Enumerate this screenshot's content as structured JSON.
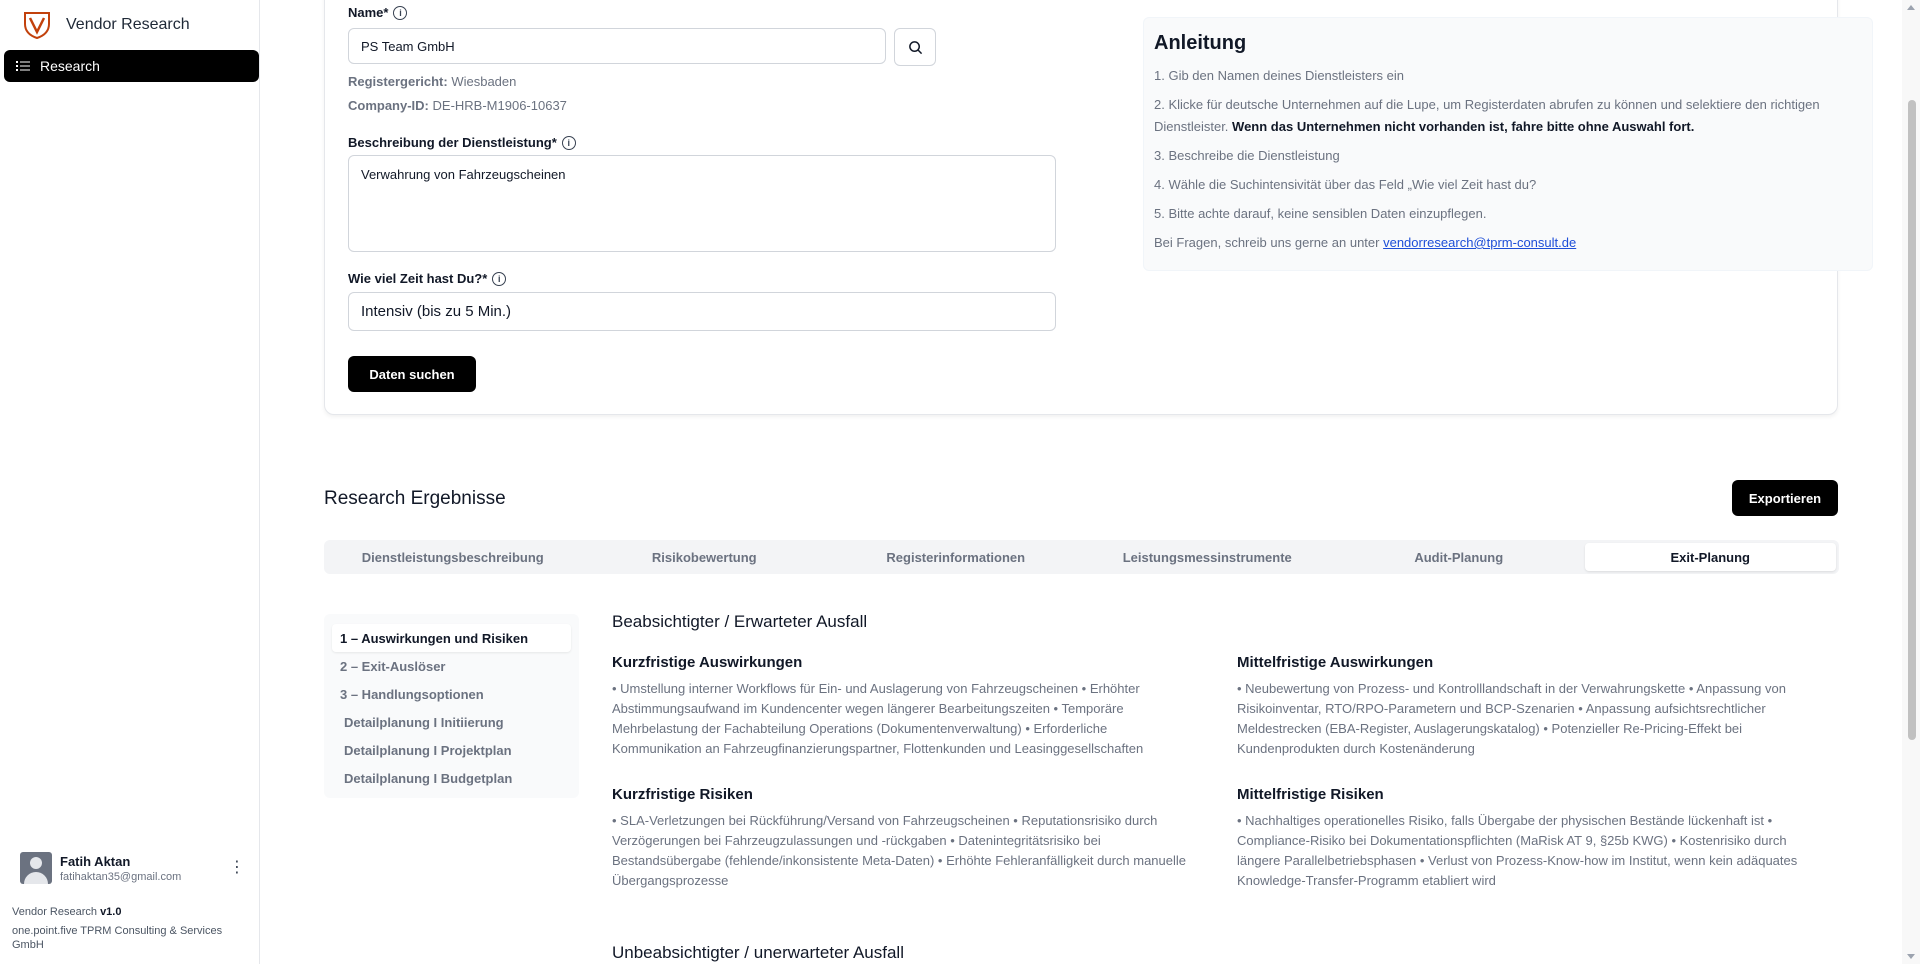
{
  "sidebar": {
    "brand": "Vendor Research",
    "nav_research": "Research",
    "user_name": "Fatih Aktan",
    "user_email": "fatihaktan35@gmail.com",
    "version_label": "Vendor Research",
    "version": "v1.0",
    "company": "one.point.five TPRM Consulting & Services GmbH"
  },
  "form": {
    "name_label": "Name*",
    "name_value": "PS Team GmbH",
    "register_label": "Registergericht:",
    "register_value": "Wiesbaden",
    "company_id_label": "Company-ID:",
    "company_id_value": "DE-HRB-M1906-10637",
    "desc_label": "Beschreibung der Dienstleistung*",
    "desc_value": "Verwahrung von Fahrzeugscheinen",
    "time_label": "Wie viel Zeit hast Du?*",
    "time_value": "Intensiv (bis zu 5 Min.)",
    "search_button": "Daten suchen"
  },
  "guide": {
    "title": "Anleitung",
    "step1": "1. Gib den Namen deines Dienstleisters ein",
    "step2": "2. Klicke für deutsche Unternehmen auf die Lupe, um Registerdaten abrufen zu können und selektiere den richtigen Dienstleister.",
    "step2_bold": "Wenn das Unternehmen nicht vorhanden ist, fahre bitte ohne Auswahl fort.",
    "step3": "3. Beschreibe die Dienstleistung",
    "step4": "4. Wähle die Suchintensivität über das Feld „Wie viel Zeit hast du?",
    "step5": "5. Bitte achte darauf, keine sensiblen Daten einzupflegen.",
    "contact_text": "Bei Fragen, schreib uns gerne an unter",
    "contact_email": "vendorresearch@tprm-consult.de"
  },
  "results": {
    "title": "Research Ergebnisse",
    "export_button": "Exportieren",
    "tabs": [
      "Dienstleistungsbeschreibung",
      "Risikobewertung",
      "Registerinformationen",
      "Leistungsmessinstrumente",
      "Audit-Planung",
      "Exit-Planung"
    ],
    "subnav": [
      "1 – Auswirkungen und Risiken",
      "2 – Exit-Auslöser",
      "3 – Handlungsoptionen",
      "Detailplanung I Initiierung",
      "Detailplanung I Projektplan",
      "Detailplanung I Budgetplan"
    ],
    "section1_title": "Beabsichtigter / Erwarteter Ausfall",
    "short_impact_title": "Kurzfristige Auswirkungen",
    "short_impact_text": "• Umstellung interner Workflows für Ein- und Auslagerung von Fahrzeugscheinen • Erhöhter Abstimmungsaufwand im Kundencenter wegen längerer Bearbeitungszeiten • Temporäre Mehrbelastung der Fachabteilung Operations (Dokumentenverwaltung) • Erforderliche Kommunikation an Fahrzeugfinanzierungspartner, Flottenkunden und Leasinggesellschaften",
    "mid_impact_title": "Mittelfristige Auswirkungen",
    "mid_impact_text": "• Neubewertung von Prozess- und Kontrolllandschaft in der Verwahrungskette • Anpassung von Risikoinventar, RTO/RPO-Parametern und BCP-Szenarien • Anpassung aufsichtsrechtlicher Meldestrecken (EBA-Register, Auslagerungskatalog) • Potenzieller Re-Pricing-Effekt bei Kundenprodukten durch Kostenänderung",
    "short_risk_title": "Kurzfristige Risiken",
    "short_risk_text": "• SLA-Verletzungen bei Rückführung/Versand von Fahrzeugscheinen • Reputationsrisiko durch Verzögerungen bei Fahrzeugzulassungen und -rückgaben • Datenintegritätsrisiko bei Bestandsübergabe (fehlende/inkonsistente Meta-Daten) • Erhöhte Fehleranfälligkeit durch manuelle Übergangsprozesse",
    "mid_risk_title": "Mittelfristige Risiken",
    "mid_risk_text": "• Nachhaltiges operationelles Risiko, falls Übergabe der physischen Bestände lückenhaft ist • Compliance-Risiko bei Dokumentationspflichten (MaRisk AT 9, §25b KWG) • Kostenrisiko durch längere Parallelbetriebsphasen • Verlust von Prozess-Know-how im Institut, wenn kein adäquates Knowledge-Transfer-Programm etabliert wird",
    "section2_title": "Unbeabsichtigter / unerwarteter Ausfall"
  }
}
